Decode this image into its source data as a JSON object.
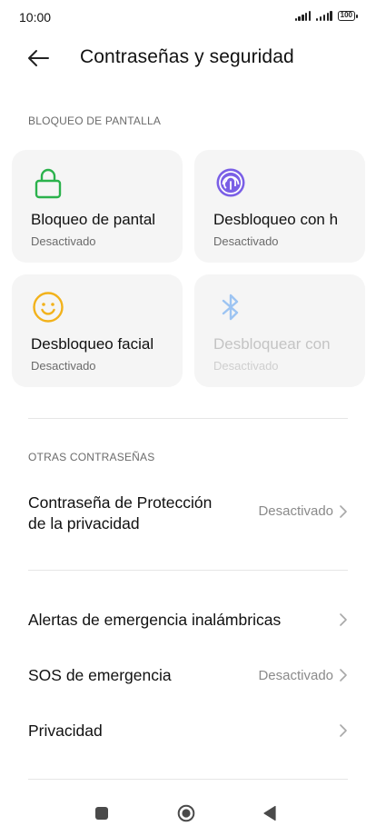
{
  "status_bar": {
    "time": "10:00",
    "battery": "100"
  },
  "header": {
    "title": "Contraseñas y seguridad",
    "back_icon": "back-arrow-icon"
  },
  "screen_lock": {
    "section_label": "BLOQUEO DE PANTALLA",
    "cards": [
      {
        "title": "Bloqueo de pantal",
        "status": "Desactivado",
        "icon": "lock-icon",
        "icon_color": "#2bb24c",
        "enabled": true
      },
      {
        "title": "Desbloqueo con h",
        "status": "Desactivado",
        "icon": "fingerprint-icon",
        "icon_color": "#7a5fe6",
        "enabled": true
      },
      {
        "title": "Desbloqueo facial",
        "status": "Desactivado",
        "icon": "face-icon",
        "icon_color": "#f2b21b",
        "enabled": true
      },
      {
        "title": "Desbloquear con",
        "status": "Desactivado",
        "icon": "bluetooth-icon",
        "icon_color": "#9dc4f2",
        "enabled": false
      }
    ]
  },
  "other_passwords": {
    "section_label": "OTRAS CONTRASEÑAS",
    "privacy_protection": {
      "title_line1": "Contraseña de Protección",
      "title_line2": "de la privacidad",
      "value": "Desactivado"
    }
  },
  "list": {
    "wireless_alerts": {
      "title": "Alertas de emergencia inalámbricas"
    },
    "emergency_sos": {
      "title": "SOS de emergencia",
      "value": "Desactivado"
    },
    "privacy": {
      "title": "Privacidad"
    }
  },
  "navigation": {
    "recent_icon": "square-icon",
    "home_icon": "home-circle-icon",
    "back_icon": "triangle-back-icon"
  }
}
